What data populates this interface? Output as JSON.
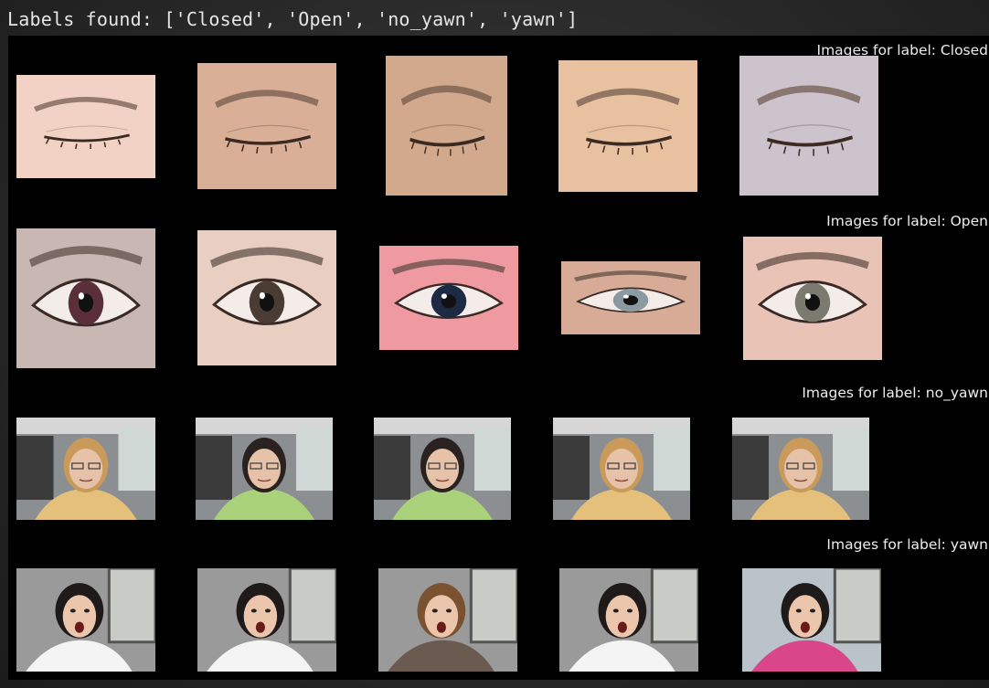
{
  "console": {
    "text": "Labels found: ['Closed', 'Open', 'no_yawn', 'yawn']"
  },
  "figure": {
    "rows": [
      {
        "label": "Closed",
        "title": "Images for label: Closed",
        "kind": "closed",
        "tones": [
          "#f2d2c4",
          "#d9b097",
          "#d3a98e",
          "#e8c1a1",
          "#cdc3cc"
        ]
      },
      {
        "label": "Open",
        "title": "Images for label: Open",
        "kind": "open",
        "tones": [
          "#c9b7b4",
          "#e8cfc2",
          "#ef9aa0",
          "#d7ab95",
          "#e9c3b6"
        ]
      },
      {
        "label": "no_yawn",
        "title": "Images for label: no_yawn",
        "kind": "driver",
        "tones": [
          "#e5c07a",
          "#a9d27a",
          "#a9d27a",
          "#e5c07a",
          "#e5c07a"
        ]
      },
      {
        "label": "yawn",
        "title": "Images for label: yawn",
        "kind": "yawn",
        "tones": [
          "#f4f4f4",
          "#f4f4f4",
          "#6b5a4f",
          "#f4f4f4",
          "#d9468a"
        ]
      }
    ]
  }
}
